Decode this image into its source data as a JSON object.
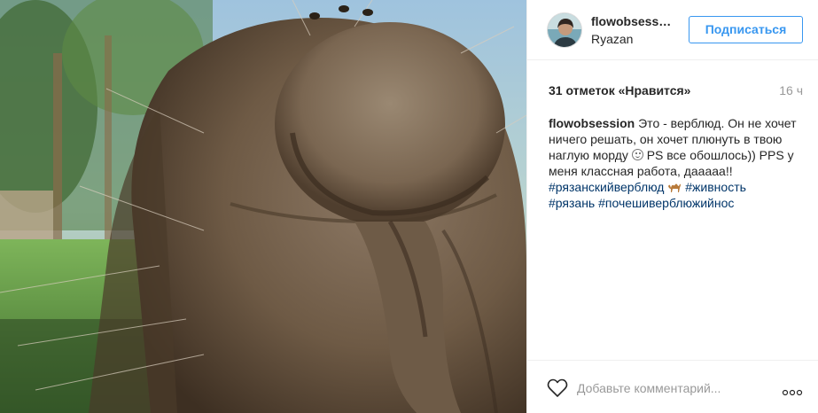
{
  "post": {
    "photo_alt": "",
    "header": {
      "username": "flowobsession",
      "location": "Ryazan",
      "follow_label": "Подписаться",
      "avatar_icon": "user-avatar"
    },
    "likes_text": "31 отметок «Нравится»",
    "time_text": "16 ч",
    "caption": {
      "author": "flowobsession",
      "text_1": " Это - верблюд. Он не хочет ничего решать, он хочет плюнуть в твою наглую морду ",
      "emoji_1": "smile-emoji",
      "text_2": " PS все обошлось)) PPS у меня классная работа, дааааа!! ",
      "hashtags": [
        "#рязанскийверблюд",
        "#живность",
        "#рязань",
        "#почешиверблюжийнос"
      ],
      "emoji_2": "camel-emoji"
    },
    "footer": {
      "comment_placeholder": "Добавьте комментарий...",
      "like_icon": "heart-icon",
      "more_icon": "more-options-icon"
    }
  },
  "colors": {
    "accent": "#3897f0",
    "hashtag": "#003569",
    "muted": "#999999",
    "text": "#262626",
    "border": "#efefef"
  }
}
